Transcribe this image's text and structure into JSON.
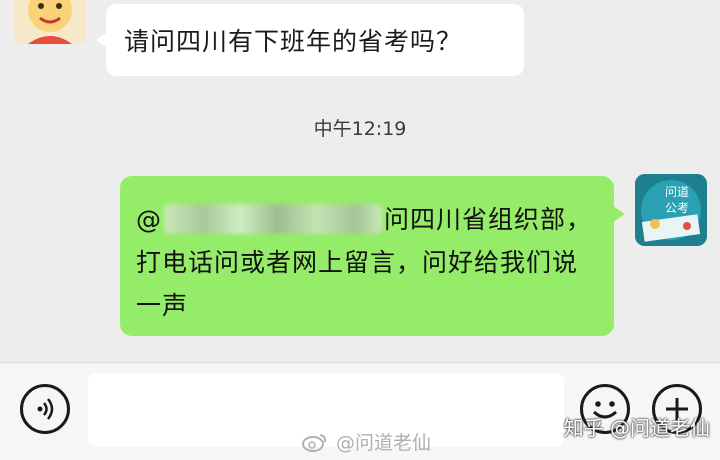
{
  "messages": {
    "incoming": {
      "text": "请问四川有下班年的省考吗？"
    },
    "timestamp": "中午12:19",
    "outgoing": {
      "mention_prefix": "@",
      "text": "问四川省组织部，打电话问或者网上留言，问好给我们说一声"
    },
    "outgoing_avatar": {
      "line1": "问道",
      "line2": "公考"
    }
  },
  "input_bar": {
    "placeholder": ""
  },
  "watermarks": {
    "weibo": "@问道老仙",
    "zhihu": "知乎 @问道老仙"
  },
  "colors": {
    "outgoing_bubble": "#95ec69",
    "incoming_bubble": "#ffffff",
    "background": "#ededed"
  }
}
